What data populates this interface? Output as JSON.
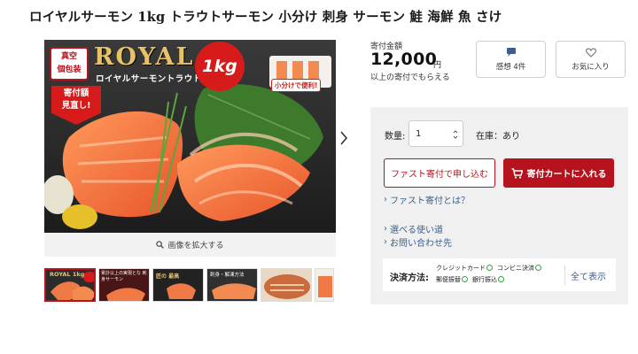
{
  "title": "ロイヤルサーモン 1kg トラウトサーモン 小分け 刺身 サーモン 鮭 海鮮 魚 さけ",
  "gallery": {
    "main": {
      "badge_line1": "真空",
      "badge_line2": "個包装",
      "brand": "ROYAL",
      "brand_sub": "ロイヤルサーモントラウト",
      "weight": "1kg",
      "arrow_line1": "寄付額",
      "arrow_line2": "見直し!",
      "pack_note": "小分けで便利!"
    },
    "zoom_label": "画像を拡大する",
    "thumbs": [
      {
        "label": "ROYAL 1kg"
      },
      {
        "label": "累計以上の実現とな 刺身サーモン"
      },
      {
        "label": "匠の 最高"
      },
      {
        "label": "刺身・解凍方法"
      },
      {
        "label": ""
      },
      {
        "label": ""
      }
    ]
  },
  "price": {
    "label": "寄付金額",
    "amount": "12,000",
    "unit": "円",
    "sub": "以上の寄付でもらえる"
  },
  "actions": {
    "review_label": "感想 4件",
    "favorite_label": "お気に入り"
  },
  "purchase": {
    "qty_label": "数量:",
    "qty_value": "1",
    "stock_label": "在庫：あり",
    "fast_button": "ファスト寄付で申し込む",
    "cart_button": "寄付カートに入れる",
    "links": [
      "ファスト寄付とは？",
      "選べる使い道",
      "お問い合わせ先"
    ]
  },
  "payment": {
    "title": "決済方法:",
    "methods": [
      "クレジットカード",
      "コンビニ決済",
      "郵便振替",
      "銀行振込"
    ],
    "show_all": "全て表示"
  },
  "colors": {
    "accent": "#b7131e",
    "link": "#3a5f8a",
    "available": "#3aa146"
  }
}
